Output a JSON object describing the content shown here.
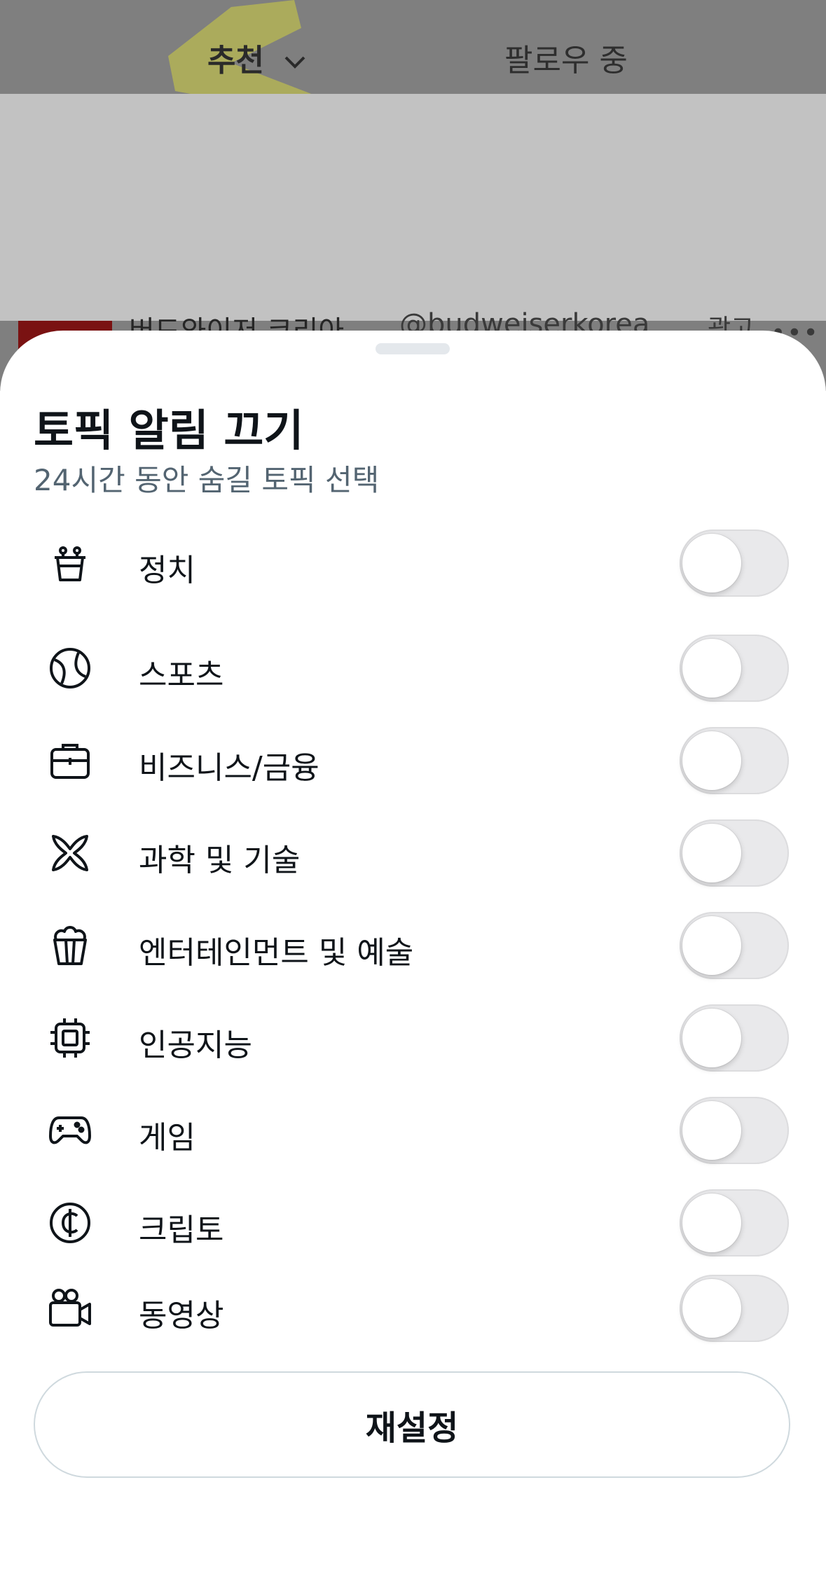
{
  "background": {
    "tabs": [
      {
        "label": "추천"
      },
      {
        "label": "팔로우 중"
      }
    ],
    "post": {
      "author": "버드와이저 코리아",
      "handle": "@budweiserkorea",
      "time": "광고"
    }
  },
  "sheet": {
    "title": "토픽 알림 끄기",
    "subtitle": "24시간 동안 숨길 토픽 선택",
    "topics": [
      {
        "label": "정치",
        "icon": "politics-icon",
        "enabled": false
      },
      {
        "label": "스포츠",
        "icon": "sports-ball-icon",
        "enabled": false
      },
      {
        "label": "비즈니스/금융",
        "icon": "briefcase-icon",
        "enabled": false
      },
      {
        "label": "과학 및 기술",
        "icon": "atom-icon",
        "enabled": false
      },
      {
        "label": "엔터테인먼트 및 예술",
        "icon": "popcorn-icon",
        "enabled": false
      },
      {
        "label": "인공지능",
        "icon": "chip-icon",
        "enabled": false
      },
      {
        "label": "게임",
        "icon": "gamepad-icon",
        "enabled": false
      },
      {
        "label": "크립토",
        "icon": "crypto-coin-icon",
        "enabled": false
      },
      {
        "label": "동영상",
        "icon": "video-camera-icon",
        "enabled": false
      }
    ],
    "reset_label": "재설정"
  },
  "colors": {
    "overlay": "#7f7f7f",
    "toggle_off": "#e9e9eb",
    "text_primary": "#0f1419",
    "text_secondary": "#536471"
  }
}
